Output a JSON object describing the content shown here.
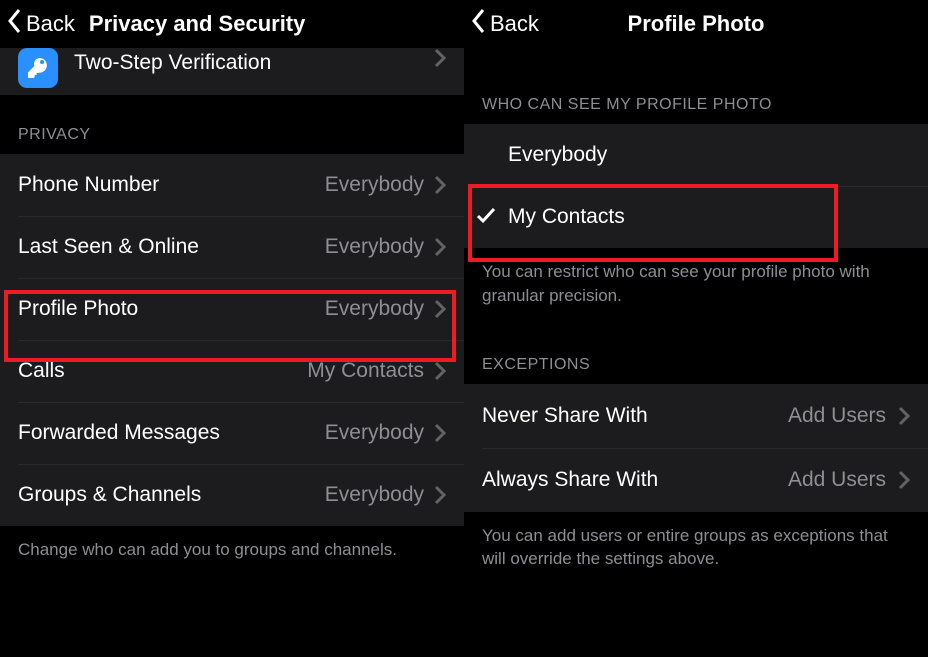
{
  "left": {
    "nav": {
      "back": "Back",
      "title": "Privacy and Security"
    },
    "top_item": {
      "label": "Two-Step Verification"
    },
    "privacy_header": "PRIVACY",
    "items": [
      {
        "label": "Phone Number",
        "value": "Everybody"
      },
      {
        "label": "Last Seen & Online",
        "value": "Everybody"
      },
      {
        "label": "Profile Photo",
        "value": "Everybody"
      },
      {
        "label": "Calls",
        "value": "My Contacts"
      },
      {
        "label": "Forwarded Messages",
        "value": "Everybody"
      },
      {
        "label": "Groups & Channels",
        "value": "Everybody"
      }
    ],
    "footer": "Change who can add you to groups and channels."
  },
  "right": {
    "nav": {
      "back": "Back",
      "title": "Profile Photo"
    },
    "who_header": "WHO CAN SEE MY PROFILE PHOTO",
    "options": [
      {
        "label": "Everybody",
        "selected": false
      },
      {
        "label": "My Contacts",
        "selected": true
      }
    ],
    "who_footer": "You can restrict who can see your profile photo with granular precision.",
    "exceptions_header": "EXCEPTIONS",
    "exceptions": [
      {
        "label": "Never Share With",
        "value": "Add Users"
      },
      {
        "label": "Always Share With",
        "value": "Add Users"
      }
    ],
    "exceptions_footer": "You can add users or entire groups as exceptions that will override the settings above."
  }
}
